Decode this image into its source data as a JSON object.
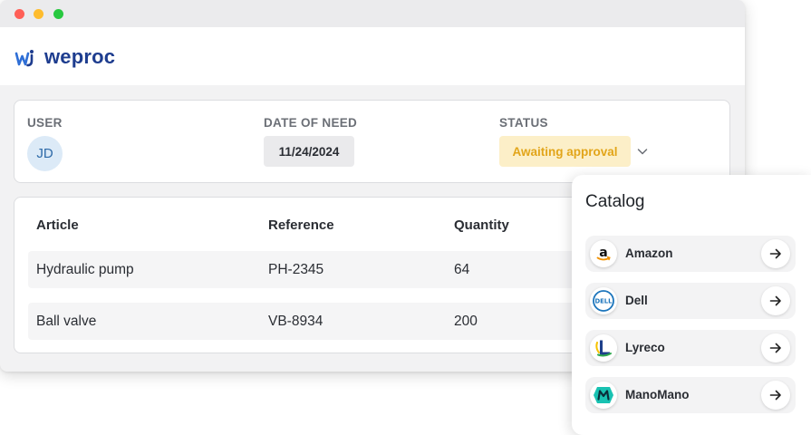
{
  "brand": {
    "name": "weproc",
    "color": "#1e3d8f"
  },
  "request": {
    "user_label": "USER",
    "user_initials": "JD",
    "date_label": "DATE OF NEED",
    "date_value": "11/24/2024",
    "status_label": "STATUS",
    "status_value": "Awaiting approval",
    "status_color": "#e2a51a"
  },
  "table": {
    "headers": [
      "Article",
      "Reference",
      "Quantity"
    ],
    "rows": [
      [
        "Hydraulic pump",
        "PH-2345",
        "64"
      ],
      [
        "Ball valve",
        "VB-8934",
        "200"
      ]
    ]
  },
  "catalog": {
    "title": "Catalog",
    "vendors": [
      {
        "name": "Amazon",
        "icon": "amazon-logo"
      },
      {
        "name": "Dell",
        "icon": "dell-logo"
      },
      {
        "name": "Lyreco",
        "icon": "lyreco-logo"
      },
      {
        "name": "ManoMano",
        "icon": "manomano-logo"
      }
    ]
  }
}
